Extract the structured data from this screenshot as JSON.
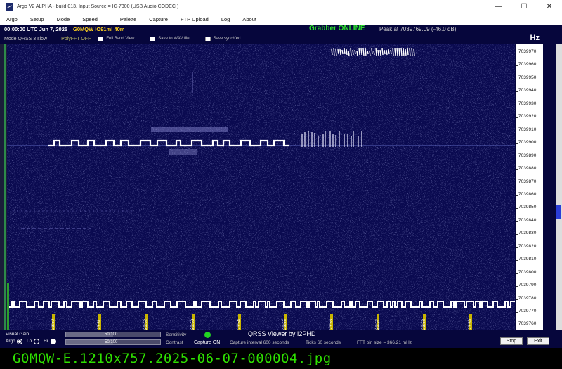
{
  "window": {
    "title": "Argo V2 ALPHA - build 013, Input Source = IC-7300 (USB Audio CODEC )",
    "minimize": "—",
    "maximize": "☐",
    "close": "✕"
  },
  "menu": [
    "Argo",
    "Setup",
    "Mode",
    "Speed",
    "Palette",
    "Capture",
    "FTP Upload",
    "Log",
    "About"
  ],
  "status": {
    "time": "00:00:00 UTC  Jun 7, 2025",
    "callsign": "G0MQW IO91ml 40m",
    "grabber": "Grabber ONLINE",
    "peak": "Peak at 7039769.09 (-46.0 dB)"
  },
  "options": {
    "mode": "Mode  QRSS 3  slow",
    "polyfft": "PolyFFT OFF",
    "full_band_view": "Full Band View",
    "save_wav": "Save to WAV file",
    "save_synched": "Save synch'ed"
  },
  "scale": {
    "unit": "Hz",
    "labels": [
      "7039970",
      "7039960",
      "7039950",
      "7039940",
      "7039930",
      "7039920",
      "7039910",
      "7039900",
      "7039890",
      "7039880",
      "7039870",
      "7039860",
      "7039850",
      "7039840",
      "7039830",
      "7039820",
      "7039810",
      "7039800",
      "7039790",
      "7039780",
      "7039770",
      "7039760"
    ]
  },
  "time_markers": [
    "23:50",
    "23:51",
    "23:52",
    "23:53",
    "23:54",
    "23:55",
    "23:56",
    "23:57",
    "23:58",
    "23:59"
  ],
  "bottom": {
    "visual_gain": "Visual Gain",
    "argo": "Argo",
    "lo": "Lo",
    "hi": "Hi",
    "sensitivity": "Sensitivity",
    "contrast": "Contrast",
    "sensitivity_value": "50/100",
    "contrast_value": "50/100",
    "sensitivity_level": 0.5,
    "contrast_level": 0.5,
    "capture": "Capture ON",
    "capture_interval": "Capture interval 600 seconds",
    "ticks": "Ticks  60 seconds",
    "fft_bin": "FFT bin size = 366.21 mHz",
    "qrss_viewer": "QRSS Viewer by I2PHD",
    "stop": "Stop",
    "exit": "Exit"
  },
  "caption": "G0MQW-E.1210x757.2025-06-07-000004.jpg",
  "colors": {
    "waterfall_bg": "#0a0a50",
    "panel_bg": "#06063c",
    "signal": "#ffffff",
    "grabber": "#2ee02e",
    "callsign": "#ffd21e",
    "caption": "#2ee000"
  }
}
